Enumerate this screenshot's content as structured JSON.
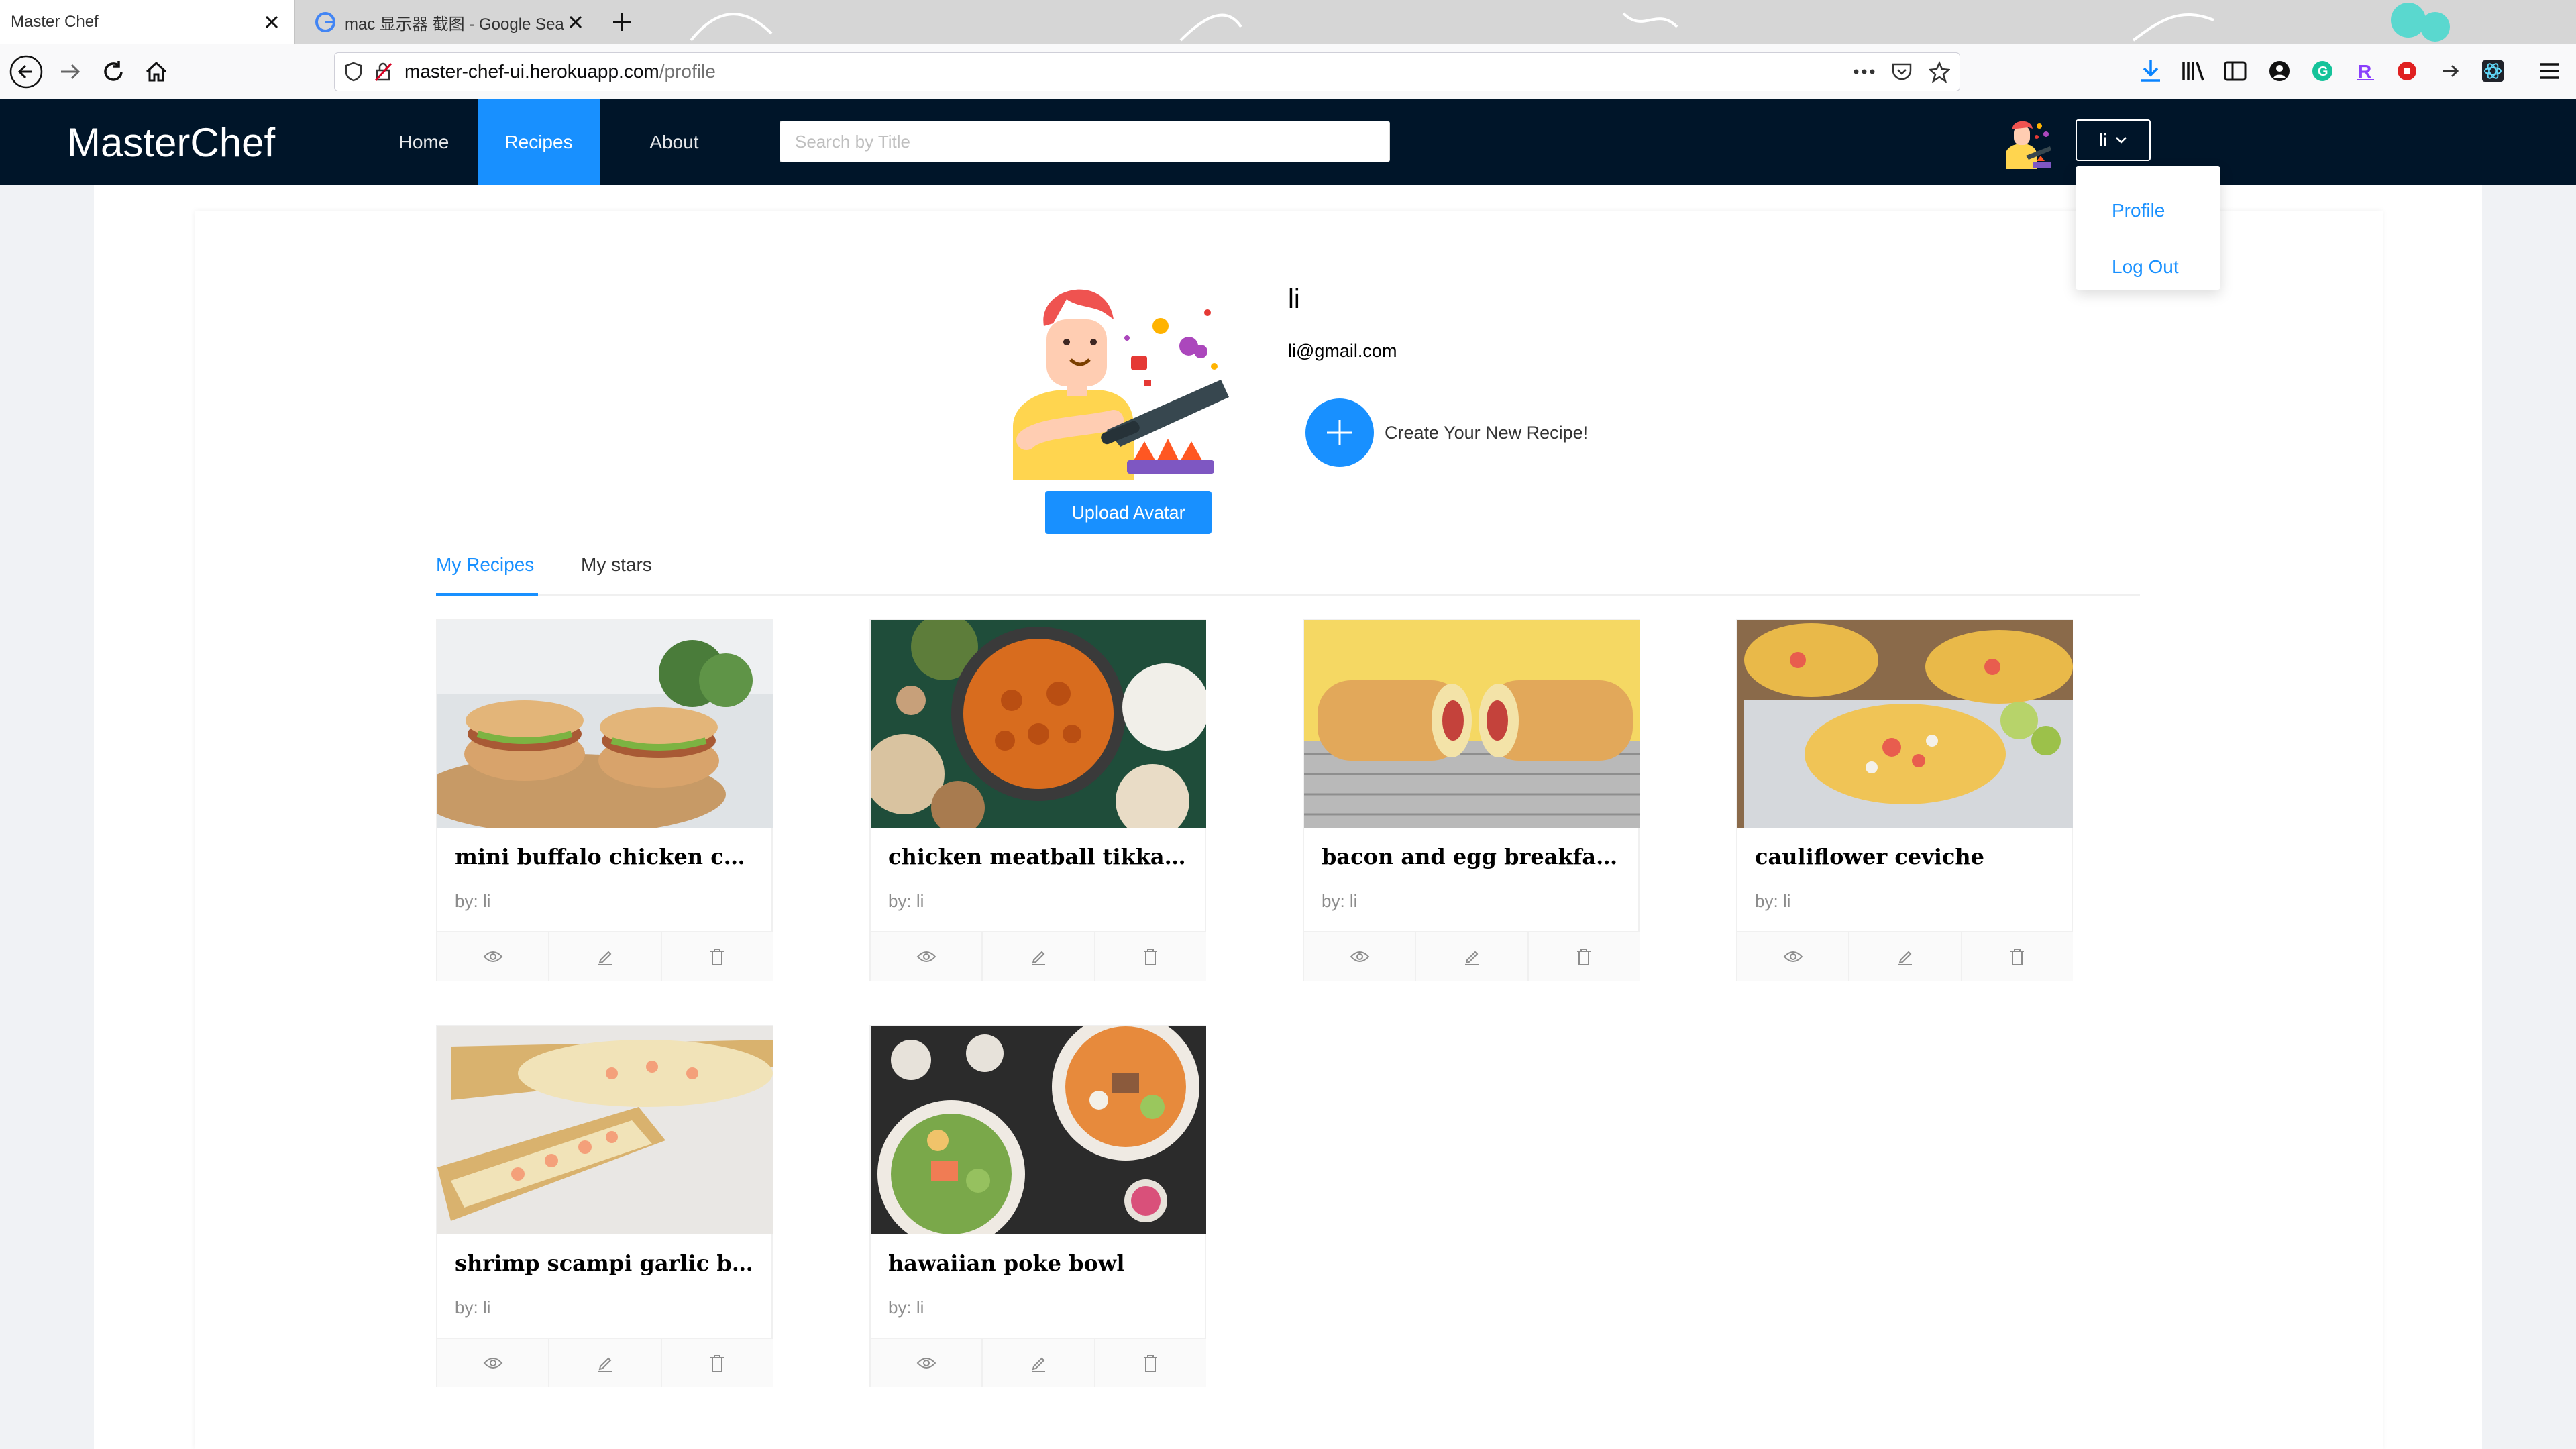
{
  "browser": {
    "tabs": [
      {
        "title": "Master Chef",
        "active": true
      },
      {
        "title": "mac 显示器 截图 - Google Search",
        "active": false
      }
    ],
    "url_host": "master-chef-ui.herokuapp.com",
    "url_path": "/profile"
  },
  "header": {
    "logo": "MasterChef",
    "menu": [
      {
        "label": "Home",
        "selected": false
      },
      {
        "label": "Recipes",
        "selected": true
      },
      {
        "label": "About",
        "selected": false
      }
    ],
    "search_placeholder": "Search by Title",
    "user_label": "li"
  },
  "dropdown": {
    "items": [
      "Profile",
      "Log Out"
    ]
  },
  "profile": {
    "name": "li",
    "email": "li@gmail.com",
    "create_label": "Create Your New Recipe!",
    "upload_label": "Upload Avatar"
  },
  "tabs": [
    {
      "label": "My Recipes",
      "active": true
    },
    {
      "label": "My stars",
      "active": false
    }
  ],
  "recipes": [
    {
      "title": "mini buffalo chicken cheese...",
      "byline": "by: li"
    },
    {
      "title": "chicken meatball tikka mas...",
      "byline": "by: li"
    },
    {
      "title": "bacon and egg breakfast str...",
      "byline": "by: li"
    },
    {
      "title": "cauliflower ceviche",
      "byline": "by: li"
    },
    {
      "title": "shrimp scampi garlic bread",
      "byline": "by: li"
    },
    {
      "title": "hawaiian poke bowl",
      "byline": "by: li"
    }
  ],
  "colors": {
    "header_bg": "#001529",
    "primary": "#1890ff"
  },
  "icons": {
    "view": "eye-icon",
    "edit": "edit-icon",
    "delete": "delete-icon"
  }
}
